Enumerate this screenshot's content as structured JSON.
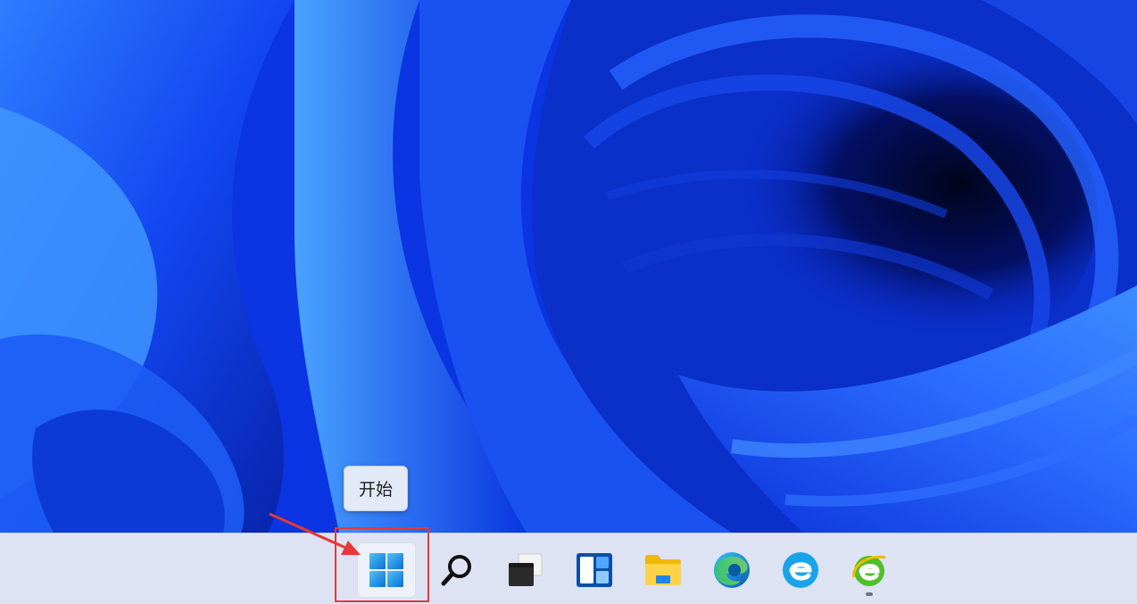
{
  "desktop": {
    "wallpaper": "windows-11-bloom-blue",
    "colors": {
      "base": "#0a2fd8",
      "dark": "#020a3e",
      "light": "#3f8dff"
    }
  },
  "tooltip": {
    "text": "开始"
  },
  "taskbar": {
    "items": [
      {
        "name": "start-button",
        "icon": "windows-logo-icon",
        "active": true
      },
      {
        "name": "search-button",
        "icon": "search-icon"
      },
      {
        "name": "task-view-button",
        "icon": "task-view-icon"
      },
      {
        "name": "widgets-button",
        "icon": "widgets-icon"
      },
      {
        "name": "file-explorer-button",
        "icon": "folder-icon"
      },
      {
        "name": "edge-button",
        "icon": "edge-icon"
      },
      {
        "name": "ie-blue-button",
        "icon": "ie-blue-icon"
      },
      {
        "name": "ie-green-button",
        "icon": "ie-green-icon",
        "running": true
      }
    ]
  },
  "annotation": {
    "highlight_color": "#e53935"
  }
}
